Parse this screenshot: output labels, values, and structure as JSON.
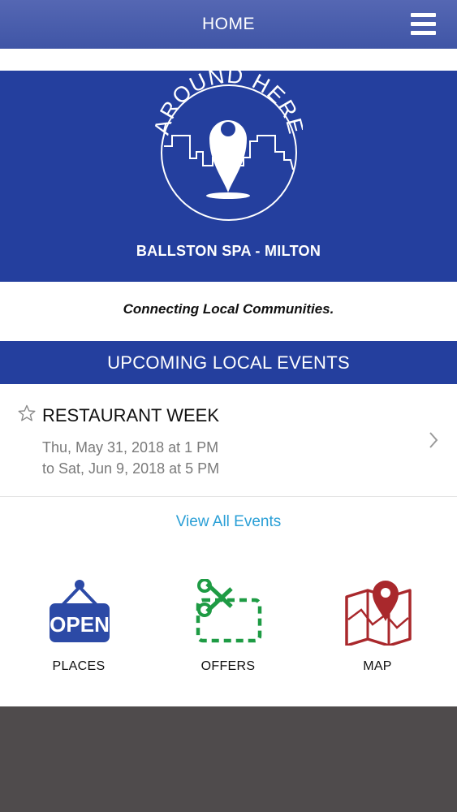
{
  "header": {
    "title": "HOME",
    "menu_icon": "hamburger-menu-icon"
  },
  "hero": {
    "logo_text": "AROUND HERE",
    "community": "BALLSTON SPA - MILTON"
  },
  "tagline": "Connecting Local Communities.",
  "events": {
    "heading": "UPCOMING LOCAL EVENTS",
    "items": [
      {
        "title": "RESTAURANT WEEK",
        "start": "Thu, May 31, 2018 at 1 PM",
        "end": "to Sat, Jun 9, 2018 at 5 PM",
        "favorite_icon": "star-outline-icon",
        "chevron_icon": "chevron-right-icon"
      }
    ],
    "view_all": "View All Events"
  },
  "tiles": [
    {
      "label": "PLACES",
      "icon": "open-sign-icon",
      "icon_text": "OPEN",
      "color": "#2c4aa6"
    },
    {
      "label": "OFFERS",
      "icon": "scissors-coupon-icon",
      "color": "#1e9b44"
    },
    {
      "label": "MAP",
      "icon": "map-pin-icon",
      "color": "#a9282c"
    }
  ],
  "colors": {
    "brand_blue": "#243f9e",
    "link_blue": "#2a9fd6",
    "footer_gray": "#4f4b4c"
  }
}
